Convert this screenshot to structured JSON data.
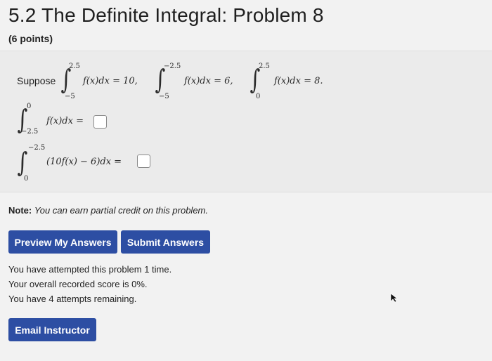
{
  "header": {
    "title": "5.2 The Definite Integral: Problem 8",
    "points": "(6 points)"
  },
  "problem": {
    "suppose_label": "Suppose",
    "given": [
      {
        "lower": "−5",
        "upper": "2.5",
        "integrand": "f(x)dx = 10,"
      },
      {
        "lower": "−5",
        "upper": "−2.5",
        "integrand": "f(x)dx = 6,"
      },
      {
        "lower": "0",
        "upper": "2.5",
        "integrand": "f(x)dx = 8."
      }
    ],
    "questions": [
      {
        "lower": "−2.5",
        "upper": "0",
        "integrand": "f(x)dx ="
      },
      {
        "lower": "0",
        "upper": "−2.5",
        "integrand": "(10f(x) − 6)dx ="
      }
    ]
  },
  "note": {
    "label": "Note:",
    "text": "You can earn partial credit on this problem."
  },
  "buttons": {
    "preview": "Preview My Answers",
    "submit": "Submit Answers",
    "email": "Email Instructor"
  },
  "status": {
    "attempts": "You have attempted this problem 1 time.",
    "score": "Your overall recorded score is 0%.",
    "remaining": "You have 4 attempts remaining."
  }
}
